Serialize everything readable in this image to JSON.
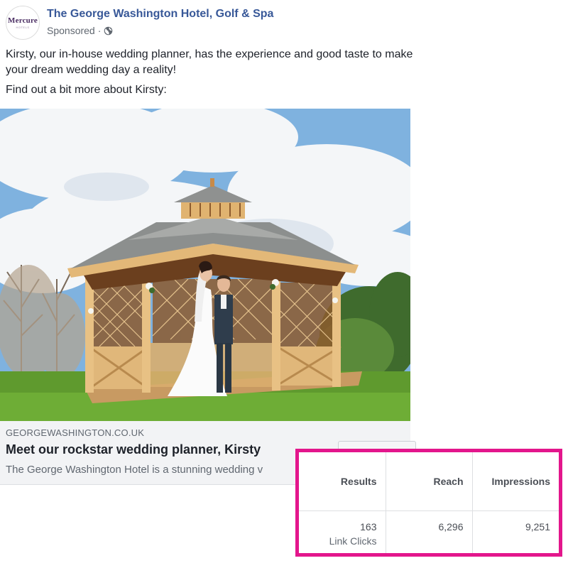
{
  "post": {
    "page_name": "The George Washington Hotel, Golf & Spa",
    "sponsored": "Sponsored",
    "separator": "·",
    "avatar_text": "Mercure",
    "avatar_subtext": "HOTELS",
    "body": [
      "Kirsty, our in-house wedding planner, has the experience and good taste to make your dream wedding day a reality!",
      "Find out a bit more about Kirsty:"
    ]
  },
  "link_preview": {
    "domain": "GEORGEWASHINGTON.CO.UK",
    "headline": "Meet our rockstar wedding planner, Kirsty",
    "description": "The George Washington Hotel is a stunning wedding v"
  },
  "results_table": {
    "headers": [
      "Results",
      "Reach",
      "Impressions"
    ],
    "row": {
      "results_value": "163",
      "results_label": "Link Clicks",
      "reach": "6,296",
      "impressions": "9,251"
    },
    "highlight_color": "#e3168c"
  },
  "colors": {
    "page_name": "#385898",
    "secondary_text": "#606770",
    "link_box_bg": "#f2f3f5"
  },
  "icons": {
    "privacy": "globe-icon"
  }
}
